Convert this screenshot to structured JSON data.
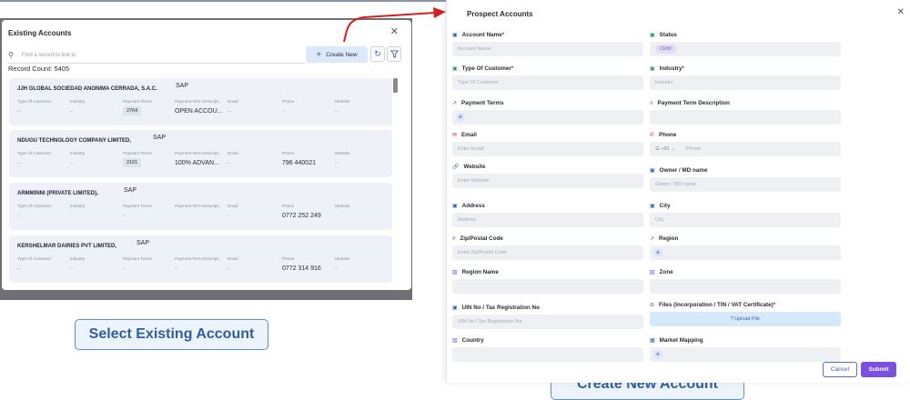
{
  "existing_accounts": {
    "title": "Existing Accounts",
    "search_placeholder": "Find a record to link to",
    "create_new_label": "Create New",
    "record_count": "Record Count: 5405",
    "columns": [
      "Type Of Customer",
      "Industry",
      "Payment Terms",
      "Payment Term Descript...",
      "Email",
      "Phone",
      "Website"
    ],
    "accounts": [
      {
        "name": "JJH GLOBAL SOCIEDAD ANONIMA CERRADA, S.A.C.",
        "tag": "SAP",
        "values": [
          "–",
          "–",
          "2764",
          "OPEN ACCOU...",
          "–",
          "–",
          "–"
        ]
      },
      {
        "name": "NDUGU TECHNOLOGY COMPANY LIMITED,",
        "tag": "SAP",
        "values": [
          "–",
          "–",
          "2101",
          "100% ADVAN...",
          "–",
          "796 440021",
          "–"
        ]
      },
      {
        "name": "ARMMINNI (PRIVATE LIMITED),",
        "tag": "SAP",
        "values": [
          "–",
          "–",
          "–",
          "–",
          "–",
          "0772 252 249",
          "–"
        ]
      },
      {
        "name": "KERSHELMAR DAIRIES PVT LIMITED,",
        "tag": "SAP",
        "values": [
          "–",
          "–",
          "–",
          "–",
          "–",
          "0772 314 916",
          "–"
        ]
      }
    ]
  },
  "captions": {
    "left": "Select Existing Account",
    "right": "Create New Account"
  },
  "prospect": {
    "title": "Prospect Accounts",
    "fields": {
      "account_name": {
        "label": "Account Name",
        "required": "*",
        "placeholder": "Account Name"
      },
      "status": {
        "label": "Status",
        "value": "CRM"
      },
      "type_of_customer": {
        "label": "Type Of Customer",
        "required": "*",
        "placeholder": "Type Of Customer"
      },
      "industry": {
        "label": "Industry",
        "required": "*",
        "placeholder": "Industry"
      },
      "payment_terms": {
        "label": "Payment Terms"
      },
      "payment_term_description": {
        "label": "Payment Term Description"
      },
      "email": {
        "label": "Email",
        "placeholder": "Enter Email"
      },
      "phone": {
        "label": "Phone",
        "prefix": "+91",
        "placeholder": "Phone"
      },
      "website": {
        "label": "Website",
        "placeholder": "Enter Website"
      },
      "owner": {
        "label": "Owner / MD name",
        "placeholder": "Owner / MD name"
      },
      "address": {
        "label": "Address",
        "placeholder": "Address"
      },
      "city": {
        "label": "City",
        "placeholder": "City"
      },
      "zip": {
        "label": "Zip/Postal Code",
        "placeholder": "Enter Zip/Postal Code"
      },
      "region": {
        "label": "Region"
      },
      "region_name": {
        "label": "Region Name"
      },
      "zone": {
        "label": "Zone"
      },
      "uin": {
        "label": "UIN No / Tax Registration No",
        "placeholder": "UIN No / Tax Registration No"
      },
      "files": {
        "label": "Files (Incorporation / TIN / VAT Certificate)",
        "required": "*",
        "button": "Upload File"
      },
      "country": {
        "label": "Country"
      },
      "market_mapping": {
        "label": "Market Mapping"
      }
    },
    "cancel_label": "Cancel",
    "submit_label": "Submit"
  },
  "colors": {
    "accent": "#3b63b8",
    "submit": "#7b4fe0",
    "arrow": "#d42020",
    "caption_text": "#2f5da3"
  }
}
